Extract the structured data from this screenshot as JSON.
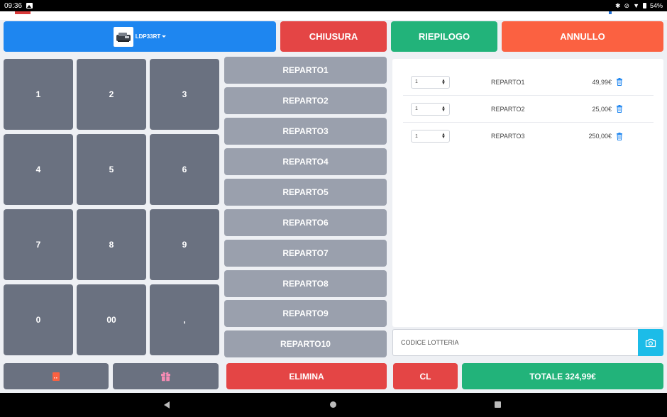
{
  "status_bar": {
    "time": "09:36",
    "battery": "54%"
  },
  "header": {
    "printer_name": "LDP33RT",
    "chiusura_label": "CHIUSURA",
    "riepilogo_label": "RIEPILOGO",
    "annullo_label": "ANNULLO"
  },
  "keypad": [
    "1",
    "2",
    "3",
    "4",
    "5",
    "6",
    "7",
    "8",
    "9",
    "0",
    "00",
    ","
  ],
  "reparti": [
    "REPARTO1",
    "REPARTO2",
    "REPARTO3",
    "REPARTO4",
    "REPARTO5",
    "REPARTO6",
    "REPARTO7",
    "REPARTO8",
    "REPARTO9",
    "REPARTO10"
  ],
  "cart": {
    "items": [
      {
        "qty": "1",
        "name": "REPARTO1",
        "price": "49,99€"
      },
      {
        "qty": "1",
        "name": "REPARTO2",
        "price": "25,00€"
      },
      {
        "qty": "1",
        "name": "REPARTO3",
        "price": "250,00€"
      }
    ]
  },
  "lotteria": {
    "placeholder": "CODICE LOTTERIA"
  },
  "footer": {
    "elimina_label": "ELIMINA",
    "cl_label": "CL",
    "totale_label": "TOTALE 324,99€"
  },
  "colors": {
    "blue": "#1e86f0",
    "red": "#e44545",
    "green": "#22b37a",
    "orange": "#fb6141",
    "key_gray": "#6a7180",
    "reparto_gray": "#9aa0ad",
    "cyan": "#1cbce8",
    "gift_pink": "#f48bb3"
  }
}
